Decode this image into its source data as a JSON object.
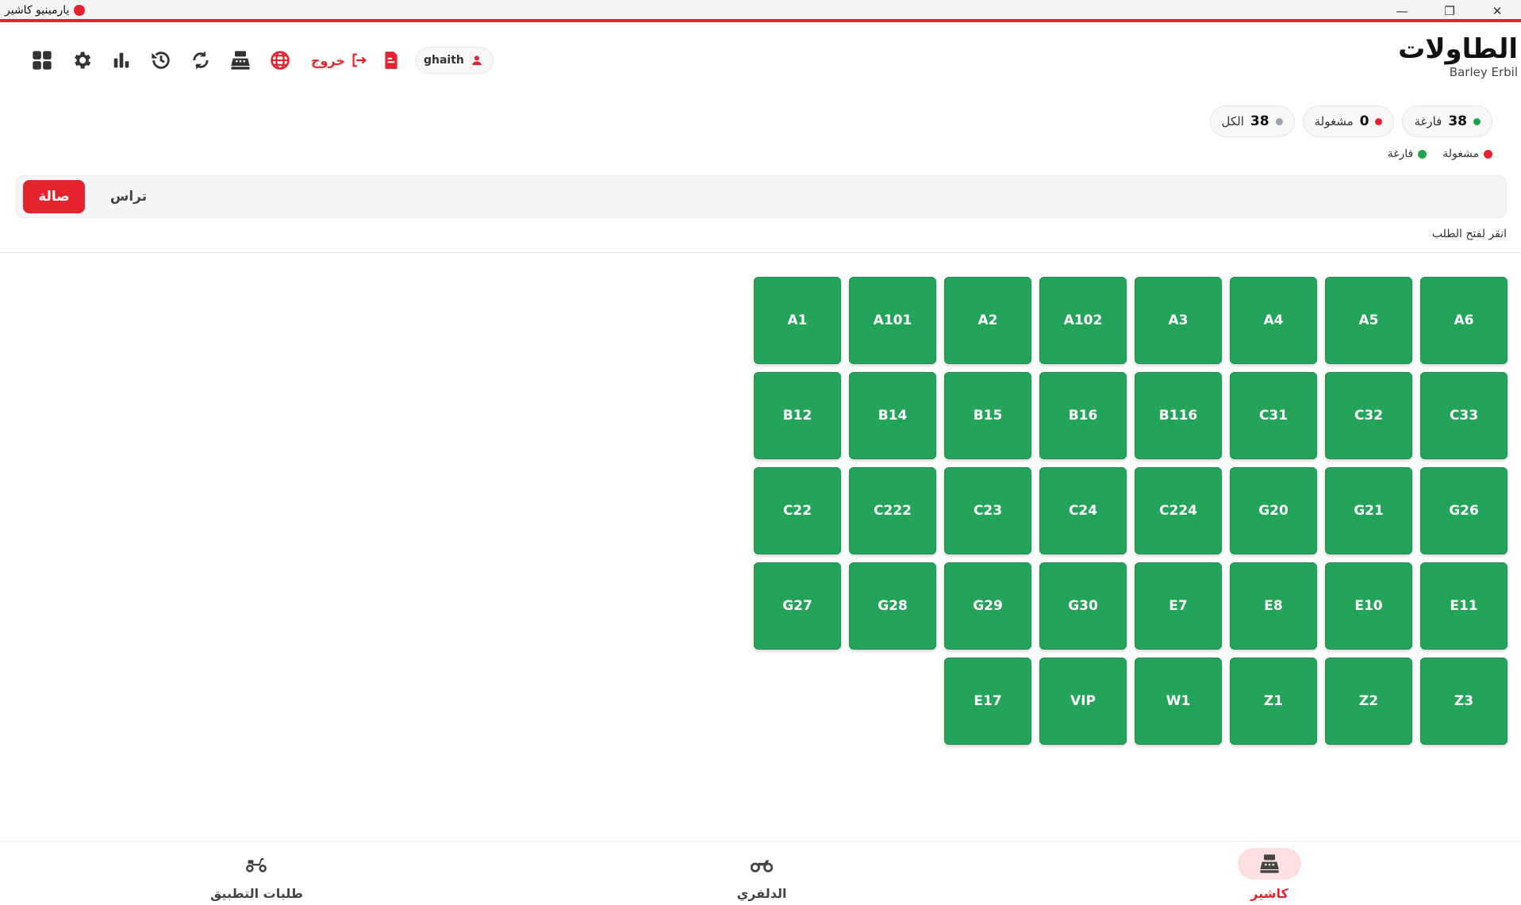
{
  "window": {
    "title": "يارمينيو كاشير",
    "minimize": "—",
    "maximize": "❐",
    "close": "✕"
  },
  "header": {
    "title": "الطاولات",
    "branch": "Barley Erbil",
    "user": "ghaith",
    "logout_label": "خروج"
  },
  "stats": [
    {
      "count": "38",
      "label": "فارغة",
      "color": "#1ea34f"
    },
    {
      "count": "0",
      "label": "مشغولة",
      "color": "#e5232e"
    },
    {
      "count": "38",
      "label": "الكل",
      "color": "#9ca3af"
    }
  ],
  "legend": [
    {
      "label": "فارغة",
      "color": "#1ea34f"
    },
    {
      "label": "مشغولة",
      "color": "#e5232e"
    }
  ],
  "sections": [
    {
      "label": "صالة",
      "active": true
    },
    {
      "label": "تراس",
      "active": false
    }
  ],
  "hint": "انقر لفتح الطلب",
  "tables": [
    "A6",
    "A5",
    "A4",
    "A3",
    "A102",
    "A2",
    "A101",
    "A1",
    "C33",
    "C32",
    "C31",
    "B116",
    "B16",
    "B15",
    "B14",
    "B12",
    "G26",
    "G21",
    "G20",
    "C224",
    "C24",
    "C23",
    "C222",
    "C22",
    "E11",
    "E10",
    "E8",
    "E7",
    "G30",
    "G29",
    "G28",
    "G27",
    "Z3",
    "Z2",
    "Z1",
    "W1",
    "VIP",
    "E17"
  ],
  "bottom_nav": [
    {
      "label": "كاشير",
      "icon": "cash-register-icon",
      "active": true
    },
    {
      "label": "الدلفري",
      "icon": "motorcycle-icon",
      "active": false
    },
    {
      "label": "طلبات التطبيق",
      "icon": "scooter-icon",
      "active": false
    }
  ]
}
